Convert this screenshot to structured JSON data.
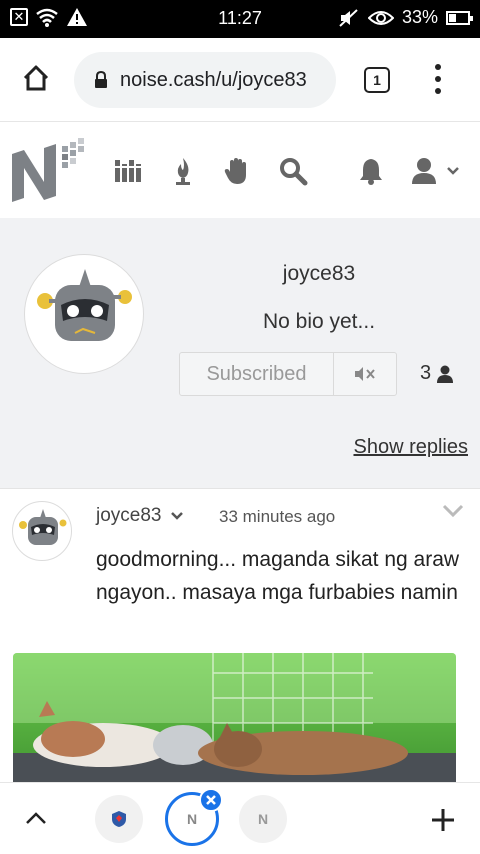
{
  "status_bar": {
    "time": "11:27",
    "battery": "33%",
    "icons": [
      "close-box-icon",
      "wifi-icon",
      "warning-icon",
      "mute-icon",
      "eye-icon",
      "battery-icon"
    ]
  },
  "browser": {
    "url": "noise.cash/u/joyce83",
    "tab_count": "1",
    "icons": [
      "home-icon",
      "lock-icon",
      "tabs-icon",
      "more-vert-icon"
    ]
  },
  "site_nav": {
    "logo": "noise.cash logo",
    "icons": [
      "library-icon",
      "fire-icon",
      "hand-icon",
      "search-icon",
      "bell-icon",
      "user-icon"
    ]
  },
  "profile": {
    "username": "joyce83",
    "bio": "No bio yet...",
    "subscribe_label": "Subscribed",
    "subscriber_count": "3",
    "show_replies": "Show replies"
  },
  "post": {
    "author": "joyce83",
    "time": "33 minutes ago",
    "text": "goodmorning... maganda sikat ng araw ngayon.. masaya mga furbabies namin"
  },
  "bottom_bar": {
    "tabs": [
      "tab-1",
      "tab-2-active",
      "tab-3"
    ],
    "thumb_letter": "N"
  },
  "colors": {
    "accent": "#1a73e8",
    "profile_bg": "#f1f2f4",
    "status_bg": "#000000"
  }
}
